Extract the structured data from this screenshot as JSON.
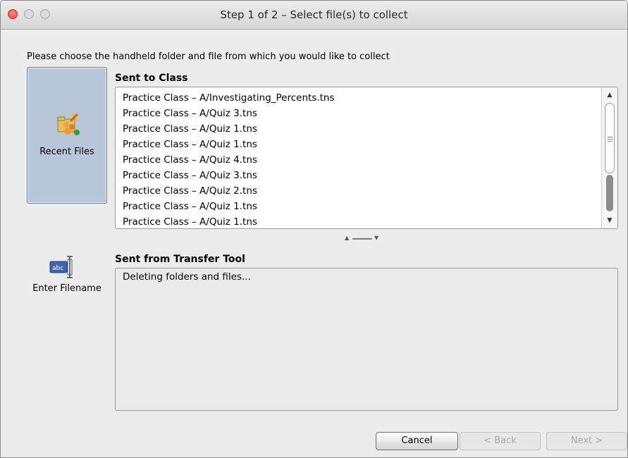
{
  "window": {
    "title": "Step 1 of 2 – Select file(s) to collect"
  },
  "instruction": "Please choose the handheld folder and file from which you would like to collect",
  "sidebar": {
    "recent_files": {
      "label": "Recent Files",
      "icon": "recent-files-icon",
      "selected": true
    },
    "enter_filename": {
      "label": "Enter Filename",
      "icon": "text-field-icon"
    }
  },
  "sent_to_class": {
    "label": "Sent to Class",
    "items": [
      "Practice Class – A/Investigating_Percents.tns",
      "Practice Class – A/Quiz 3.tns",
      "Practice Class – A/Quiz 1.tns",
      "Practice Class – A/Quiz 1.tns",
      "Practice Class – A/Quiz 4.tns",
      "Practice Class – A/Quiz 3.tns",
      "Practice Class – A/Quiz 2.tns",
      "Practice Class – A/Quiz 1.tns",
      "Practice Class – A/Quiz 1.tns"
    ]
  },
  "sent_from_transfer_tool": {
    "label": "Sent from Transfer Tool",
    "status": "Deleting folders and files..."
  },
  "buttons": {
    "cancel": "Cancel",
    "back": "< Back",
    "next": "Next >"
  },
  "colors": {
    "selected_bg": "#b9c6d9",
    "close_button": "#e0443e"
  }
}
